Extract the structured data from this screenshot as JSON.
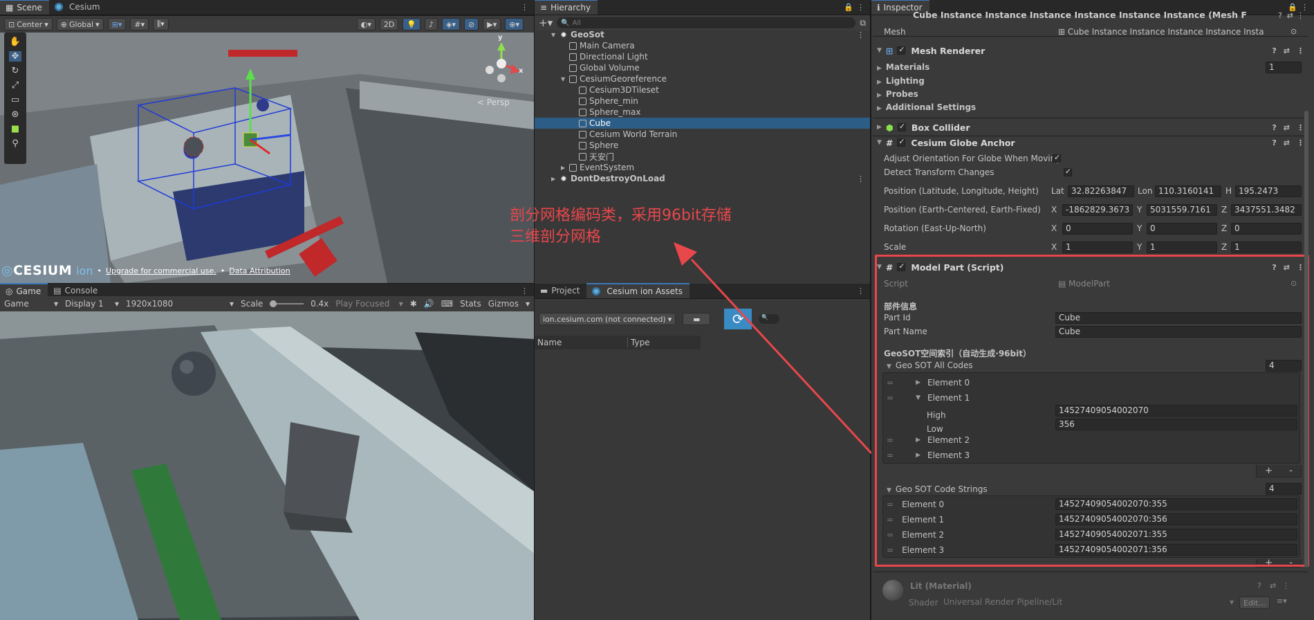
{
  "scene": {
    "tabs": [
      "Scene",
      "Cesium"
    ],
    "toolbar": {
      "pivot": "Center",
      "space": "Global",
      "mode2d": "2D"
    },
    "persp_label": "< Persp",
    "gizmo_axes": {
      "y": "y",
      "x": "x"
    },
    "footer": {
      "brand": "CESIUM",
      "ion": "ion",
      "bullet1": "•",
      "upgrade": "Upgrade for commercial use.",
      "bullet2": "•",
      "attribution": "Data Attribution"
    }
  },
  "game": {
    "tabs": [
      "Game",
      "Console"
    ],
    "mode": "Game",
    "display": "Display 1",
    "resolution": "1920x1080",
    "scale_label": "Scale",
    "scale_value": "0.4x",
    "play_focused": "Play Focused",
    "stats": "Stats",
    "gizmos": "Gizmos"
  },
  "hierarchy": {
    "tab": "Hierarchy",
    "search_placeholder": "All",
    "items": [
      {
        "label": "GeoSot",
        "depth": 0,
        "kind": "scene",
        "fold": "▼"
      },
      {
        "label": "Main Camera",
        "depth": 1,
        "kind": "obj",
        "fold": ""
      },
      {
        "label": "Directional Light",
        "depth": 1,
        "kind": "obj",
        "fold": ""
      },
      {
        "label": "Global Volume",
        "depth": 1,
        "kind": "obj",
        "fold": ""
      },
      {
        "label": "CesiumGeoreference",
        "depth": 1,
        "kind": "obj",
        "fold": "▼"
      },
      {
        "label": "Cesium3DTileset",
        "depth": 2,
        "kind": "obj",
        "fold": ""
      },
      {
        "label": "Sphere_min",
        "depth": 2,
        "kind": "obj",
        "fold": ""
      },
      {
        "label": "Sphere_max",
        "depth": 2,
        "kind": "obj",
        "fold": ""
      },
      {
        "label": "Cube",
        "depth": 2,
        "kind": "obj",
        "fold": "",
        "selected": true
      },
      {
        "label": "Cesium World Terrain",
        "depth": 2,
        "kind": "obj",
        "fold": ""
      },
      {
        "label": "Sphere",
        "depth": 2,
        "kind": "obj",
        "fold": ""
      },
      {
        "label": "天安门",
        "depth": 2,
        "kind": "obj",
        "fold": ""
      },
      {
        "label": "EventSystem",
        "depth": 1,
        "kind": "obj",
        "fold": "▶"
      },
      {
        "label": "DontDestroyOnLoad",
        "depth": 0,
        "kind": "scene",
        "fold": "▶"
      }
    ]
  },
  "annotation": {
    "line1": "剖分网格编码类，采用96bit存储",
    "line2": "三维剖分网格",
    "color": "#e8474b"
  },
  "project": {
    "tabs": [
      "Project",
      "Cesium ion Assets"
    ],
    "server": "ion.cesium.com (not connected)",
    "columns": [
      "Name",
      "Type"
    ]
  },
  "inspector": {
    "tab": "Inspector",
    "title": "Cube Instance Instance Instance Instance Instance Instance (Mesh F",
    "mesh_label": "Mesh",
    "mesh_value": "Cube Instance Instance Instance Instance Insta",
    "mesh_renderer": {
      "name": "Mesh Renderer",
      "materials": "Materials",
      "materials_count": "1",
      "lighting": "Lighting",
      "probes": "Probes",
      "additional": "Additional Settings"
    },
    "box_collider": "Box Collider",
    "anchor": {
      "name": "Cesium Globe Anchor",
      "adjust": "Adjust Orientation For Globe When Moving",
      "detect": "Detect Transform Changes",
      "pos_llh_label": "Position (Latitude, Longitude, Height)",
      "lat_label": "Lat",
      "lat": "32.82263847",
      "lon_label": "Lon",
      "lon": "110.3160141",
      "h_label": "H",
      "h": "195.2473",
      "pos_ecef_label": "Position (Earth-Centered, Earth-Fixed)",
      "ex_label": "X",
      "ex": "-1862829.3673",
      "ey_label": "Y",
      "ey": "5031559.7161",
      "ez_label": "Z",
      "ez": "3437551.3482",
      "rot_label": "Rotation (East-Up-North)",
      "rx_label": "X",
      "rx": "0",
      "ry_label": "Y",
      "ry": "0",
      "rz_label": "Z",
      "rz": "0",
      "scale_label": "Scale",
      "sx_label": "X",
      "sx": "1",
      "sy_label": "Y",
      "sy": "1",
      "sz_label": "Z",
      "sz": "1"
    },
    "model_part": {
      "name": "Model Part (Script)",
      "script_label": "Script",
      "script_value": "ModelPart",
      "section1": "部件信息",
      "part_id_label": "Part Id",
      "part_id": "Cube",
      "part_name_label": "Part Name",
      "part_name": "Cube",
      "section2": "GeoSOT空间索引（自动生成·96bit）",
      "all_codes_label": "Geo SOT All Codes",
      "all_codes_count": "4",
      "elements": [
        "Element 0",
        "Element 1",
        "Element 2",
        "Element 3"
      ],
      "high_label": "High",
      "high": "14527409054002070",
      "low_label": "Low",
      "low": "356",
      "code_strings_label": "Geo SOT Code Strings",
      "code_strings_count": "4",
      "code_strings": [
        {
          "label": "Element 0",
          "value": "14527409054002070:355"
        },
        {
          "label": "Element 1",
          "value": "14527409054002070:356"
        },
        {
          "label": "Element 2",
          "value": "14527409054002071:355"
        },
        {
          "label": "Element 3",
          "value": "14527409054002071:356"
        }
      ],
      "plus": "+",
      "minus": "-"
    },
    "material": {
      "name": "Lit (Material)",
      "shader_label": "Shader",
      "shader_value": "Universal Render Pipeline/Lit",
      "edit": "Edit..."
    }
  },
  "colors": {
    "highlight_box": "#e8474b",
    "selection": "#2c5d87",
    "accent_blue": "#3a79bb"
  }
}
